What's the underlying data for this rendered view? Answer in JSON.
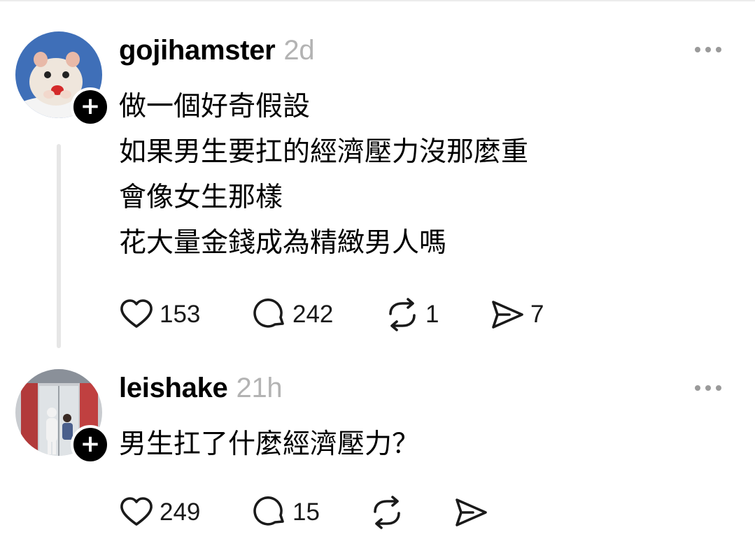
{
  "posts": [
    {
      "username": "gojihamster",
      "time": "2d",
      "avatar_icon": "hamster-avatar",
      "lines": [
        "做一個好奇假設",
        "如果男生要扛的經濟壓力沒那麼重",
        "會像女生那樣",
        "花大量金錢成為精緻男人嗎"
      ],
      "likes": "153",
      "comments": "242",
      "reposts": "1",
      "shares": "7"
    },
    {
      "username": "leishake",
      "time": "21h",
      "avatar_icon": "storefront-avatar",
      "lines": [
        "男生扛了什麼經濟壓力？"
      ],
      "likes": "249",
      "comments": "15",
      "reposts": "",
      "shares": ""
    }
  ],
  "colors": {
    "muted": "#b3b3b3",
    "thread_line": "#e6e6e6",
    "icon": "#1a1a1a"
  }
}
